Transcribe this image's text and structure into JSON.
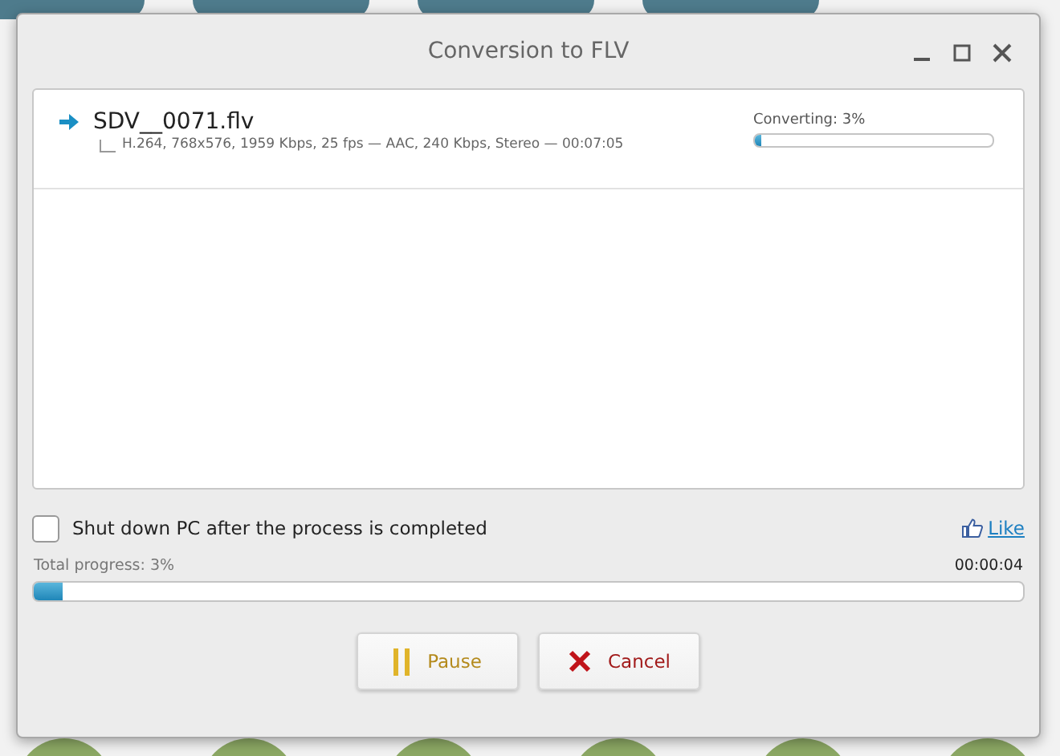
{
  "window": {
    "title": "Conversion to FLV"
  },
  "files": [
    {
      "name": "SDV__0071.flv",
      "details": "H.264, 768x576, 1959 Kbps, 25 fps — AAC, 240 Kbps, Stereo — 00:07:05",
      "status": "Converting: 3%",
      "level": 0.03
    }
  ],
  "shutdown": {
    "label": "Shut down PC after the process is completed",
    "checked": false
  },
  "like": "Like",
  "total": {
    "label": "Total progress: 3%",
    "time": "00:00:04",
    "level": 0.03
  },
  "buttons": [
    {
      "kind": "pause",
      "label": "Pause"
    },
    {
      "kind": "cancel",
      "label": "Cancel"
    }
  ]
}
